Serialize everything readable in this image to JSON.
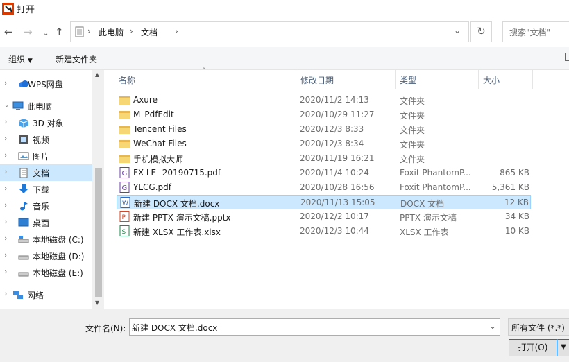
{
  "window": {
    "title": "打开"
  },
  "address": {
    "crumbs": [
      "此电脑",
      "文档"
    ],
    "search_placeholder": "搜索\"文档\""
  },
  "toolbar": {
    "organize_label": "组织",
    "new_folder_label": "新建文件夹"
  },
  "nav": {
    "items": [
      {
        "label": "WPS网盘",
        "icon": "wps-cloud-icon"
      },
      {
        "label": "此电脑",
        "icon": "computer-icon"
      },
      {
        "label": "3D 对象",
        "icon": "3d-objects-icon"
      },
      {
        "label": "视频",
        "icon": "videos-icon"
      },
      {
        "label": "图片",
        "icon": "pictures-icon"
      },
      {
        "label": "文档",
        "icon": "documents-icon"
      },
      {
        "label": "下载",
        "icon": "downloads-icon"
      },
      {
        "label": "音乐",
        "icon": "music-icon"
      },
      {
        "label": "桌面",
        "icon": "desktop-icon"
      },
      {
        "label": "本地磁盘 (C:)",
        "icon": "drive-icon"
      },
      {
        "label": "本地磁盘 (D:)",
        "icon": "drive-icon"
      },
      {
        "label": "本地磁盘 (E:)",
        "icon": "drive-icon"
      },
      {
        "label": "网络",
        "icon": "network-icon"
      }
    ]
  },
  "columns": {
    "name": "名称",
    "date": "修改日期",
    "type": "类型",
    "size": "大小"
  },
  "files": [
    {
      "name": "Axure",
      "date": "2020/11/2 14:13",
      "type": "文件夹",
      "size": "",
      "icon": "folder-icon"
    },
    {
      "name": "M_PdfEdit",
      "date": "2020/10/29 11:27",
      "type": "文件夹",
      "size": "",
      "icon": "folder-icon"
    },
    {
      "name": "Tencent Files",
      "date": "2020/12/3 8:33",
      "type": "文件夹",
      "size": "",
      "icon": "folder-icon"
    },
    {
      "name": "WeChat Files",
      "date": "2020/12/3 8:34",
      "type": "文件夹",
      "size": "",
      "icon": "folder-icon"
    },
    {
      "name": "手机模拟大师",
      "date": "2020/11/19 16:21",
      "type": "文件夹",
      "size": "",
      "icon": "folder-icon"
    },
    {
      "name": "FX-LE--20190715.pdf",
      "date": "2020/11/4 10:24",
      "type": "Foxit PhantomP...",
      "size": "865 KB",
      "icon": "pdf-icon"
    },
    {
      "name": "YLCG.pdf",
      "date": "2020/10/28 16:56",
      "type": "Foxit PhantomP...",
      "size": "5,361 KB",
      "icon": "pdf-icon"
    },
    {
      "name": "新建 DOCX 文档.docx",
      "date": "2020/11/13 15:05",
      "type": "DOCX 文档",
      "size": "12 KB",
      "icon": "docx-icon"
    },
    {
      "name": "新建 PPTX 演示文稿.pptx",
      "date": "2020/12/2 10:17",
      "type": "PPTX 演示文稿",
      "size": "34 KB",
      "icon": "pptx-icon"
    },
    {
      "name": "新建 XLSX 工作表.xlsx",
      "date": "2020/12/3 10:44",
      "type": "XLSX 工作表",
      "size": "10 KB",
      "icon": "xlsx-icon"
    }
  ],
  "footer": {
    "filename_label": "文件名(N):",
    "filename_value": "新建 DOCX 文档.docx",
    "filetype_value": "所有文件 (*.*)",
    "open_label": "打开(O)"
  }
}
